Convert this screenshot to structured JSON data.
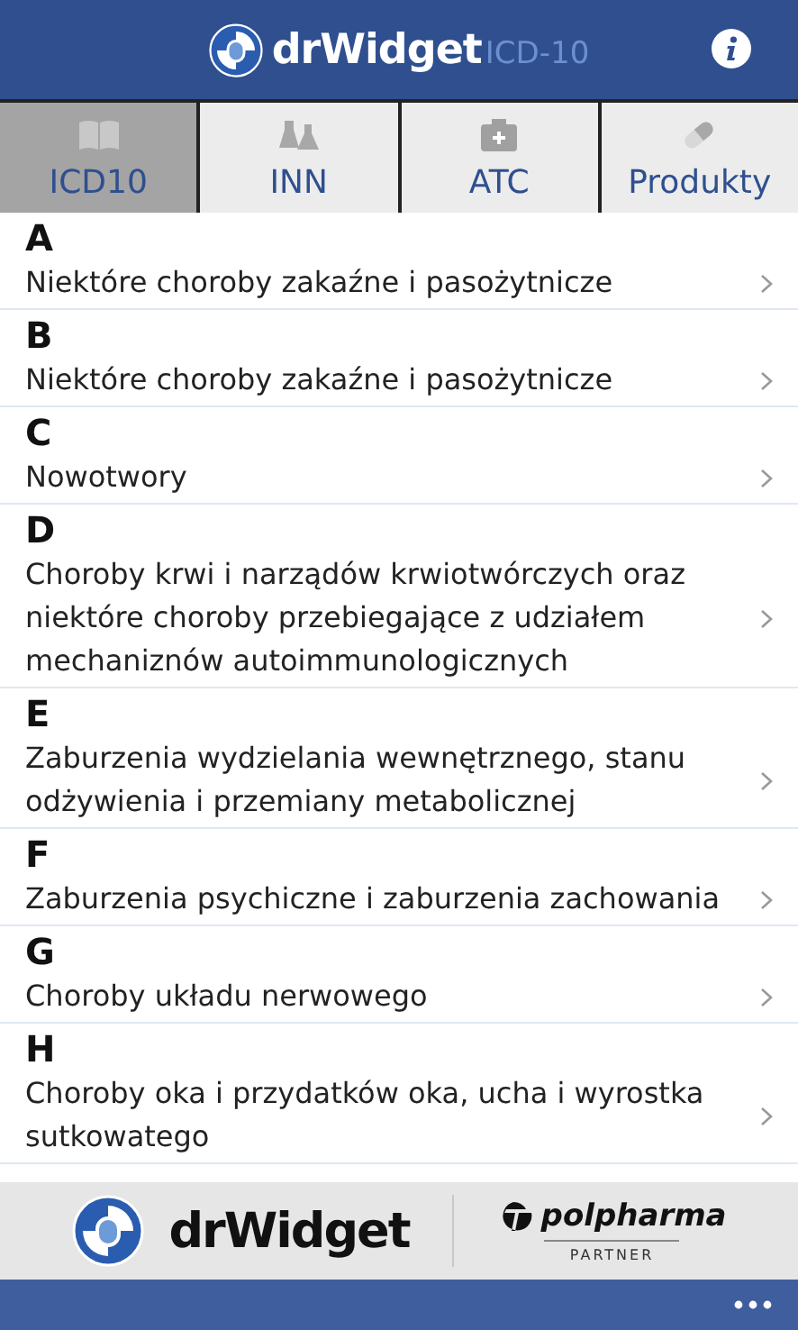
{
  "header": {
    "brand": "drWidget",
    "product": "ICD-10"
  },
  "tabs": [
    {
      "label": "ICD10",
      "selected": true
    },
    {
      "label": "INN",
      "selected": false
    },
    {
      "label": "ATC",
      "selected": false
    },
    {
      "label": "Produkty",
      "selected": false
    }
  ],
  "chapters": [
    {
      "letter": "A",
      "title": "Niektóre choroby zakaźne i pasożytnicze"
    },
    {
      "letter": "B",
      "title": "Niektóre choroby zakaźne i pasożytnicze"
    },
    {
      "letter": "C",
      "title": "Nowotwory"
    },
    {
      "letter": "D",
      "title": "Choroby krwi i narządów krwiotwórczych oraz niektóre choroby przebiegające z udziałem mechaniznów autoimmunologicznych"
    },
    {
      "letter": "E",
      "title": "Zaburzenia wydzielania wewnętrznego, stanu odżywienia i przemiany metabolicznej"
    },
    {
      "letter": "F",
      "title": "Zaburzenia psychiczne i zaburzenia zachowania"
    },
    {
      "letter": "G",
      "title": "Choroby układu nerwowego"
    },
    {
      "letter": "H",
      "title": "Choroby oka i przydatków oka, ucha i wyrostka sutkowatego"
    }
  ],
  "banner": {
    "brand": "drWidget",
    "partner": "polpharma",
    "partner_label": "PARTNER"
  }
}
